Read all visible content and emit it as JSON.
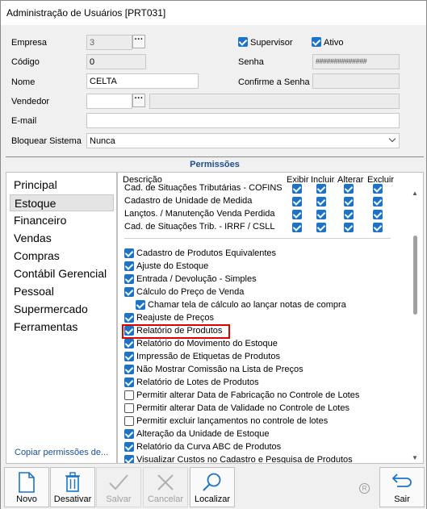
{
  "window": {
    "title": "Administração de Usuários [PRT031]"
  },
  "form": {
    "empresa_label": "Empresa",
    "empresa_value": "3",
    "codigo_label": "Código",
    "codigo_value": "0",
    "nome_label": "Nome",
    "nome_value": "CELTA",
    "vendedor_label": "Vendedor",
    "email_label": "E-mail",
    "bloquear_label": "Bloquear Sistema",
    "bloquear_value": "Nunca",
    "supervisor_label": "Supervisor",
    "ativo_label": "Ativo",
    "senha_label": "Senha",
    "senha_value": "##############",
    "confirme_label": "Confirme a Senha",
    "dots_label": "···"
  },
  "permissions": {
    "header": "Permissões",
    "nav": [
      "Principal",
      "Estoque",
      "Financeiro",
      "Vendas",
      "Compras",
      "Contábil Gerencial",
      "Pessoal",
      "Supermercado",
      "Ferramentas"
    ],
    "active_nav": "Estoque",
    "copy_link": "Copiar permissões de...",
    "columns": {
      "descricao": "Descrição",
      "exibir": "Exibir",
      "incluir": "Incluir",
      "alterar": "Alterar",
      "excluir": "Excluir"
    },
    "table_rows": [
      "Cad. de Situações Tributárias - COFINS",
      "Cadastro de Unidade de Medida",
      "Lançtos. / Manutenção Venda Perdida",
      "Cad. de Situações Trib. - IRRF / CSLL"
    ],
    "items": [
      {
        "label": "Cadastro de Produtos Equivalentes",
        "checked": true
      },
      {
        "label": "Ajuste do Estoque",
        "checked": true
      },
      {
        "label": "Entrada / Devolução - Simples",
        "checked": true
      },
      {
        "label": "Cálculo do Preço de Venda",
        "checked": true
      },
      {
        "label": "Chamar tela de cálculo ao lançar notas de compra",
        "checked": true
      },
      {
        "label": "Reajuste de Preços",
        "checked": true
      },
      {
        "label": "Relatório de Produtos",
        "checked": true
      },
      {
        "label": "Relatório do Movimento do Estoque",
        "checked": true
      },
      {
        "label": "Impressão de Etiquetas de Produtos",
        "checked": true
      },
      {
        "label": "Não Mostrar Comissão na Lista de Preços",
        "checked": true
      },
      {
        "label": "Relatório de Lotes de Produtos",
        "checked": true
      },
      {
        "label": "Permitir alterar Data de Fabricação no Controle de Lotes",
        "checked": false
      },
      {
        "label": "Permitir alterar Data de Validade no Controle de Lotes",
        "checked": false
      },
      {
        "label": "Permitir excluir lançamentos no controle de lotes",
        "checked": false
      },
      {
        "label": "Alteração da Unidade de Estoque",
        "checked": true
      },
      {
        "label": "Relatório da Curva  ABC de Produtos",
        "checked": true
      },
      {
        "label": "Visualizar Custos no Cadastro e Pesquisa de Produtos",
        "checked": true
      }
    ]
  },
  "toolbar": {
    "novo": "Novo",
    "desativar": "Desativar",
    "salvar": "Salvar",
    "cancelar": "Cancelar",
    "localizar": "Localizar",
    "sair": "Sair",
    "r_icon": "R"
  },
  "colors": {
    "accent": "#1a73c9",
    "highlight": "#e00000",
    "header_text": "#1b4f91"
  }
}
